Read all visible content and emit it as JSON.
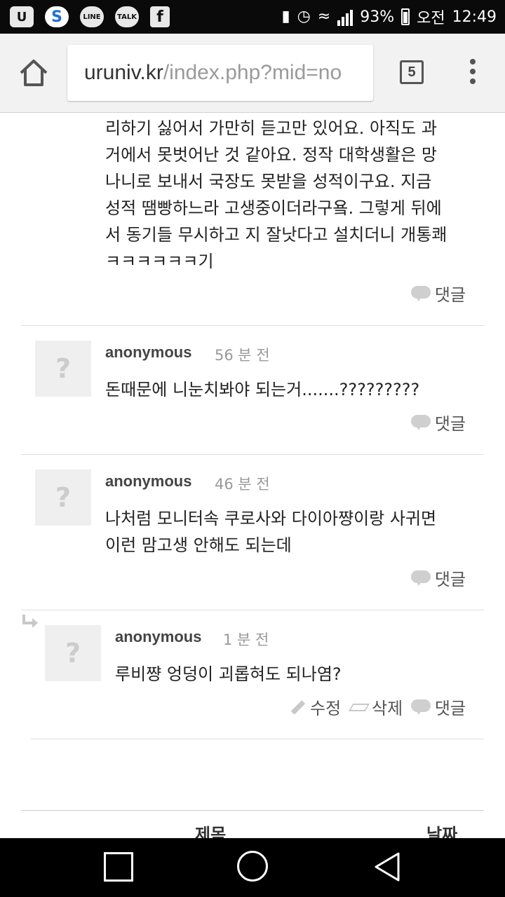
{
  "status_bar": {
    "apps": [
      "U",
      "S",
      "LINE",
      "TALK",
      "f"
    ],
    "battery": "93%",
    "ampm": "오전",
    "time": "12:49"
  },
  "browser": {
    "url_host": "uruniv.kr",
    "url_path": "/index.php?mid=no",
    "tab_count": "5"
  },
  "comments": [
    {
      "lines": [
        "리하기 싫어서 가만히 듣고만 있어요. 아직도 과",
        "거에서 못벗어난 것 같아요. 정작 대학생활은 망",
        "나니로 보내서 국장도 못받을 성적이구요. 지금",
        "성적 땜빵하느라 고생중이더라구욬. 그렇게 뒤에",
        "서 동기들 무시하고 지 잘낫다고 설치더니 개통쾌",
        "ㅋㅋㅋㅋㅋㅋ기"
      ],
      "reply_label": "댓글"
    },
    {
      "author": "anonymous",
      "time": "56 분 전",
      "lines": [
        "돈때문에 니눈치봐야 되는거.......?????????"
      ],
      "reply_label": "댓글"
    },
    {
      "author": "anonymous",
      "time": "46 분 전",
      "lines": [
        "나처럼 모니터속 쿠로사와 다이아쨩이랑 사귀면",
        "이런 맘고생 안해도 되는데"
      ],
      "reply_label": "댓글"
    },
    {
      "author": "anonymous",
      "time": "1 분 전",
      "lines": [
        "루비쨩 엉덩이 괴롭혀도 되나염?"
      ],
      "edit_label": "수정",
      "delete_label": "삭제",
      "reply_label": "댓글"
    }
  ],
  "avatar_glyph": "?",
  "table_header": {
    "title": "제목",
    "date": "날짜"
  }
}
